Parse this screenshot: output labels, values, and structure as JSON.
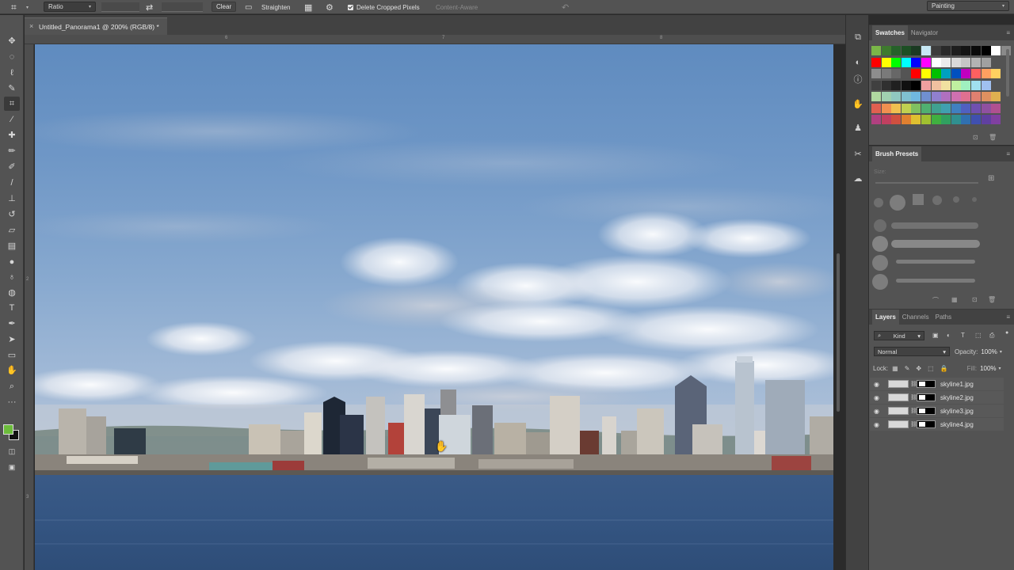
{
  "options_bar": {
    "ratio_label": "Ratio",
    "clear_label": "Clear",
    "straighten_label": "Straighten",
    "delete_cropped_label": "Delete Cropped Pixels",
    "content_aware_label": "Content-Aware",
    "workspace_label": "Painting"
  },
  "document": {
    "tab_title": "Untitled_Panorama1 @ 200% (RGB/8) *",
    "ruler_top": [
      "6",
      "7",
      "8"
    ],
    "ruler_left": [
      "2",
      "3"
    ]
  },
  "swatches_panel": {
    "tabs": [
      "Swatches",
      "Navigator"
    ],
    "row1": [
      "#7ab648",
      "#3e7a2e",
      "#26612a",
      "#1d4f24",
      "#1b3a22",
      "#c7e8f5",
      "#3c3c3c",
      "#2a2a2a",
      "#1e1e1e",
      "#141414",
      "#0a0a0a",
      "#000000",
      "#ffffff",
      "#8a8a8a"
    ],
    "row2": [
      "#ff0000",
      "#ffff00",
      "#00ff00",
      "#00ffff",
      "#0000ff",
      "#ff00ff",
      "#ffffff",
      "#ececec",
      "#d9d9d9",
      "#c6c6c6",
      "#b3b3b3",
      "#a0a0a0"
    ],
    "row3": [
      "#8d8d8d",
      "#7a7a7a",
      "#676767",
      "#545454",
      "#ff0000",
      "#ffff00",
      "#00c000",
      "#00a0c0",
      "#0050c0",
      "#c000c0",
      "#ff6060",
      "#ffa060",
      "#ffd060"
    ],
    "row4": [
      "#404040",
      "#303030",
      "#202020",
      "#101010",
      "#000000",
      "#f0a0a0",
      "#f0c0a0",
      "#f0e0a0",
      "#c0f0a0",
      "#a0f0c0",
      "#a0e0f0",
      "#a0c0f0"
    ],
    "row5": [
      "#b0d8a0",
      "#a0d0b0",
      "#90c8c0",
      "#80c0d0",
      "#70b8e0",
      "#7090d0",
      "#9080d0",
      "#b070c0",
      "#d070b0",
      "#e07090",
      "#e08070",
      "#e09060",
      "#e0b050"
    ],
    "row6": [
      "#e06050",
      "#f09050",
      "#f0c050",
      "#c0d050",
      "#80c060",
      "#50b070",
      "#40a090",
      "#40a0b0",
      "#4080c0",
      "#5060c0",
      "#7050b0",
      "#9050a0",
      "#b05090"
    ],
    "row7": [
      "#b04080",
      "#c04060",
      "#d05040",
      "#e08030",
      "#e0c030",
      "#a0c030",
      "#40b040",
      "#30a060",
      "#309090",
      "#3070b0",
      "#4050b0",
      "#6040a0",
      "#8040a0"
    ]
  },
  "brush_presets_panel": {
    "title": "Brush Presets",
    "size_label": "Size:"
  },
  "layers_panel": {
    "tabs": [
      "Layers",
      "Channels",
      "Paths"
    ],
    "kind_label": "Kind",
    "blend_mode": "Normal",
    "opacity_label": "Opacity:",
    "opacity_value": "100%",
    "lock_label": "Lock:",
    "fill_label": "Fill:",
    "fill_value": "100%",
    "layers": [
      {
        "name": "skyline1.jpg"
      },
      {
        "name": "skyline2.jpg"
      },
      {
        "name": "skyline3.jpg"
      },
      {
        "name": "skyline4.jpg"
      }
    ]
  },
  "icons": {
    "crop_tool": "crop-icon",
    "swap": "swap-icon",
    "grid": "grid-overlay-icon",
    "settings": "gear-icon",
    "reset": "reset-icon",
    "hand_cursor": "hand-cursor-icon"
  }
}
